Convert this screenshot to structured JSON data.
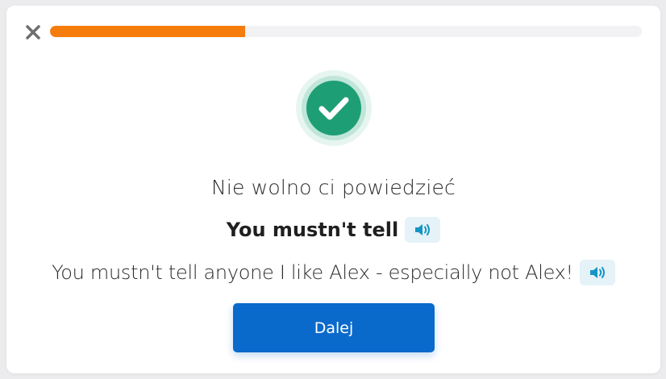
{
  "header": {
    "close_icon": "close-icon",
    "progress": {
      "fraction": 0.33,
      "fill_color": "#f67c0b",
      "track_color": "#f2f1f4"
    }
  },
  "result": {
    "status_icon": "check-circle-icon",
    "status_color": "#1e9e74"
  },
  "prompt": "Nie wolno ci powiedzieć",
  "answer": {
    "text": "You mustn't tell",
    "audio_icon": "speaker-icon"
  },
  "example": {
    "text": "You mustn't tell anyone I like Alex - especially not Alex!",
    "audio_icon": "speaker-icon"
  },
  "next_button": {
    "label": "Dalej",
    "color": "#0a6acb"
  }
}
